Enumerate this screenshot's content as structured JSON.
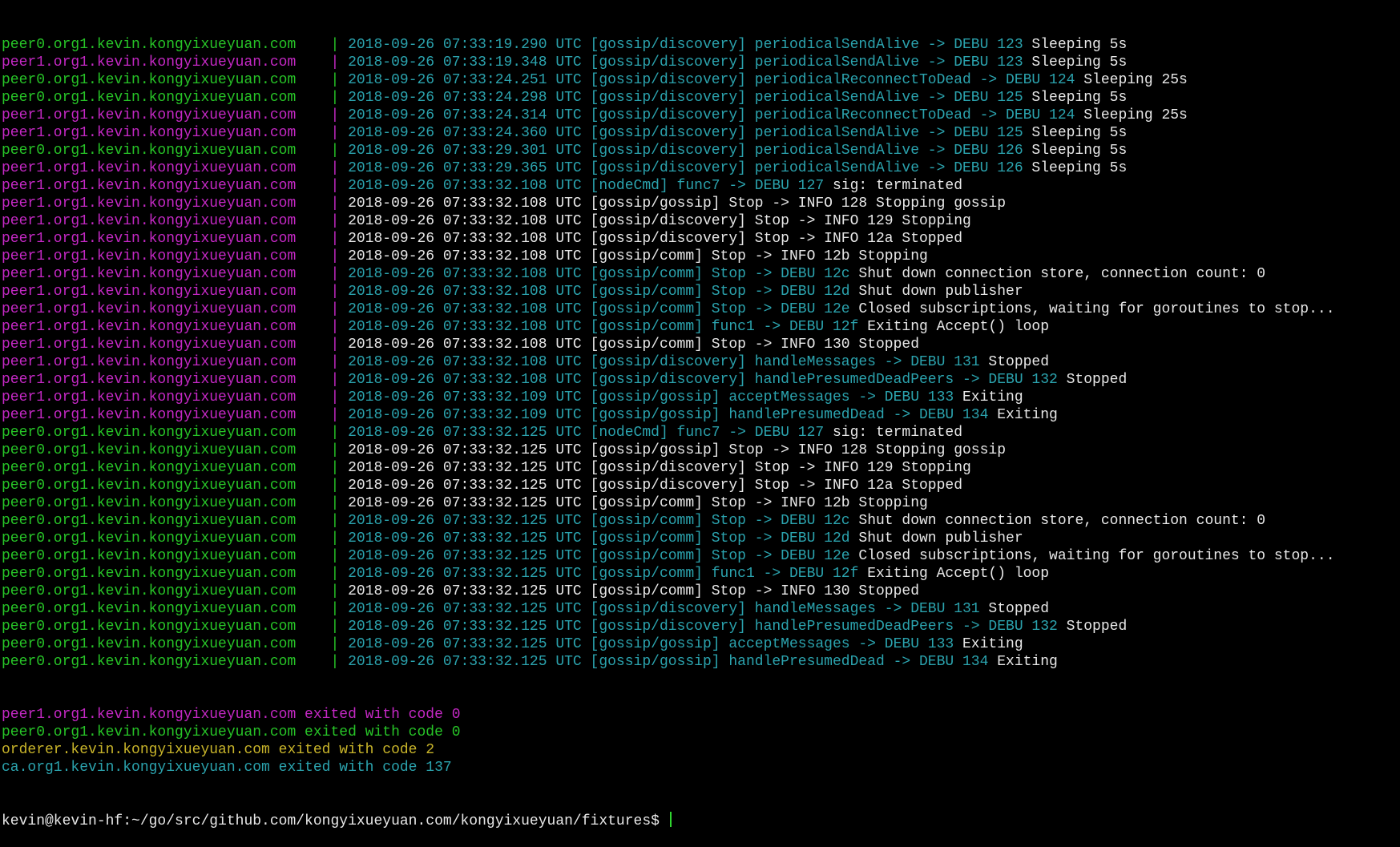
{
  "colors": {
    "green": "#27c427",
    "magenta": "#c428c4",
    "cyan": "#2ba3ae",
    "white": "#e8e8e8",
    "yellow": "#c9b52a",
    "background": "#000000"
  },
  "log_lines": [
    {
      "source": "peer0.org1.kevin.kongyixueyuan.com    ",
      "source_color": "green",
      "sep": "| ",
      "msg": "2018-09-26 07:33:19.290 UTC [gossip/discovery] periodicalSendAlive -> DEBU 123",
      "msg_color": "cyan",
      "tail": " Sleeping 5s"
    },
    {
      "source": "peer1.org1.kevin.kongyixueyuan.com    ",
      "source_color": "magenta",
      "sep": "| ",
      "msg": "2018-09-26 07:33:19.348 UTC [gossip/discovery] periodicalSendAlive -> DEBU 123",
      "msg_color": "cyan",
      "tail": " Sleeping 5s"
    },
    {
      "source": "peer0.org1.kevin.kongyixueyuan.com    ",
      "source_color": "green",
      "sep": "| ",
      "msg": "2018-09-26 07:33:24.251 UTC [gossip/discovery] periodicalReconnectToDead -> DEBU 124",
      "msg_color": "cyan",
      "tail": " Sleeping 25s"
    },
    {
      "source": "peer0.org1.kevin.kongyixueyuan.com    ",
      "source_color": "green",
      "sep": "| ",
      "msg": "2018-09-26 07:33:24.298 UTC [gossip/discovery] periodicalSendAlive -> DEBU 125",
      "msg_color": "cyan",
      "tail": " Sleeping 5s"
    },
    {
      "source": "peer1.org1.kevin.kongyixueyuan.com    ",
      "source_color": "magenta",
      "sep": "| ",
      "msg": "2018-09-26 07:33:24.314 UTC [gossip/discovery] periodicalReconnectToDead -> DEBU 124",
      "msg_color": "cyan",
      "tail": " Sleeping 25s"
    },
    {
      "source": "peer1.org1.kevin.kongyixueyuan.com    ",
      "source_color": "magenta",
      "sep": "| ",
      "msg": "2018-09-26 07:33:24.360 UTC [gossip/discovery] periodicalSendAlive -> DEBU 125",
      "msg_color": "cyan",
      "tail": " Sleeping 5s"
    },
    {
      "source": "peer0.org1.kevin.kongyixueyuan.com    ",
      "source_color": "green",
      "sep": "| ",
      "msg": "2018-09-26 07:33:29.301 UTC [gossip/discovery] periodicalSendAlive -> DEBU 126",
      "msg_color": "cyan",
      "tail": " Sleeping 5s"
    },
    {
      "source": "peer1.org1.kevin.kongyixueyuan.com    ",
      "source_color": "magenta",
      "sep": "| ",
      "msg": "2018-09-26 07:33:29.365 UTC [gossip/discovery] periodicalSendAlive -> DEBU 126",
      "msg_color": "cyan",
      "tail": " Sleeping 5s"
    },
    {
      "source": "peer1.org1.kevin.kongyixueyuan.com    ",
      "source_color": "magenta",
      "sep": "| ",
      "msg": "2018-09-26 07:33:32.108 UTC [nodeCmd] func7 -> DEBU 127",
      "msg_color": "cyan",
      "tail": " sig: terminated"
    },
    {
      "source": "peer1.org1.kevin.kongyixueyuan.com    ",
      "source_color": "magenta",
      "sep": "| ",
      "msg": "2018-09-26 07:33:32.108 UTC [gossip/gossip] Stop -> INFO 128 Stopping gossip",
      "msg_color": "white",
      "tail": ""
    },
    {
      "source": "peer1.org1.kevin.kongyixueyuan.com    ",
      "source_color": "magenta",
      "sep": "| ",
      "msg": "2018-09-26 07:33:32.108 UTC [gossip/discovery] Stop -> INFO 129 Stopping",
      "msg_color": "white",
      "tail": ""
    },
    {
      "source": "peer1.org1.kevin.kongyixueyuan.com    ",
      "source_color": "magenta",
      "sep": "| ",
      "msg": "2018-09-26 07:33:32.108 UTC [gossip/discovery] Stop -> INFO 12a Stopped",
      "msg_color": "white",
      "tail": ""
    },
    {
      "source": "peer1.org1.kevin.kongyixueyuan.com    ",
      "source_color": "magenta",
      "sep": "| ",
      "msg": "2018-09-26 07:33:32.108 UTC [gossip/comm] Stop -> INFO 12b Stopping",
      "msg_color": "white",
      "tail": ""
    },
    {
      "source": "peer1.org1.kevin.kongyixueyuan.com    ",
      "source_color": "magenta",
      "sep": "| ",
      "msg": "2018-09-26 07:33:32.108 UTC [gossip/comm] Stop -> DEBU 12c",
      "msg_color": "cyan",
      "tail": " Shut down connection store, connection count: 0"
    },
    {
      "source": "peer1.org1.kevin.kongyixueyuan.com    ",
      "source_color": "magenta",
      "sep": "| ",
      "msg": "2018-09-26 07:33:32.108 UTC [gossip/comm] Stop -> DEBU 12d",
      "msg_color": "cyan",
      "tail": " Shut down publisher"
    },
    {
      "source": "peer1.org1.kevin.kongyixueyuan.com    ",
      "source_color": "magenta",
      "sep": "| ",
      "msg": "2018-09-26 07:33:32.108 UTC [gossip/comm] Stop -> DEBU 12e",
      "msg_color": "cyan",
      "tail": " Closed subscriptions, waiting for goroutines to stop..."
    },
    {
      "source": "peer1.org1.kevin.kongyixueyuan.com    ",
      "source_color": "magenta",
      "sep": "| ",
      "msg": "2018-09-26 07:33:32.108 UTC [gossip/comm] func1 -> DEBU 12f",
      "msg_color": "cyan",
      "tail": " Exiting Accept() loop"
    },
    {
      "source": "peer1.org1.kevin.kongyixueyuan.com    ",
      "source_color": "magenta",
      "sep": "| ",
      "msg": "2018-09-26 07:33:32.108 UTC [gossip/comm] Stop -> INFO 130 Stopped",
      "msg_color": "white",
      "tail": ""
    },
    {
      "source": "peer1.org1.kevin.kongyixueyuan.com    ",
      "source_color": "magenta",
      "sep": "| ",
      "msg": "2018-09-26 07:33:32.108 UTC [gossip/discovery] handleMessages -> DEBU 131",
      "msg_color": "cyan",
      "tail": " Stopped"
    },
    {
      "source": "peer1.org1.kevin.kongyixueyuan.com    ",
      "source_color": "magenta",
      "sep": "| ",
      "msg": "2018-09-26 07:33:32.108 UTC [gossip/discovery] handlePresumedDeadPeers -> DEBU 132",
      "msg_color": "cyan",
      "tail": " Stopped"
    },
    {
      "source": "peer1.org1.kevin.kongyixueyuan.com    ",
      "source_color": "magenta",
      "sep": "| ",
      "msg": "2018-09-26 07:33:32.109 UTC [gossip/gossip] acceptMessages -> DEBU 133",
      "msg_color": "cyan",
      "tail": " Exiting"
    },
    {
      "source": "peer1.org1.kevin.kongyixueyuan.com    ",
      "source_color": "magenta",
      "sep": "| ",
      "msg": "2018-09-26 07:33:32.109 UTC [gossip/gossip] handlePresumedDead -> DEBU 134",
      "msg_color": "cyan",
      "tail": " Exiting"
    },
    {
      "source": "peer0.org1.kevin.kongyixueyuan.com    ",
      "source_color": "green",
      "sep": "| ",
      "msg": "2018-09-26 07:33:32.125 UTC [nodeCmd] func7 -> DEBU 127",
      "msg_color": "cyan",
      "tail": " sig: terminated"
    },
    {
      "source": "peer0.org1.kevin.kongyixueyuan.com    ",
      "source_color": "green",
      "sep": "| ",
      "msg": "2018-09-26 07:33:32.125 UTC [gossip/gossip] Stop -> INFO 128 Stopping gossip",
      "msg_color": "white",
      "tail": ""
    },
    {
      "source": "peer0.org1.kevin.kongyixueyuan.com    ",
      "source_color": "green",
      "sep": "| ",
      "msg": "2018-09-26 07:33:32.125 UTC [gossip/discovery] Stop -> INFO 129 Stopping",
      "msg_color": "white",
      "tail": ""
    },
    {
      "source": "peer0.org1.kevin.kongyixueyuan.com    ",
      "source_color": "green",
      "sep": "| ",
      "msg": "2018-09-26 07:33:32.125 UTC [gossip/discovery] Stop -> INFO 12a Stopped",
      "msg_color": "white",
      "tail": ""
    },
    {
      "source": "peer0.org1.kevin.kongyixueyuan.com    ",
      "source_color": "green",
      "sep": "| ",
      "msg": "2018-09-26 07:33:32.125 UTC [gossip/comm] Stop -> INFO 12b Stopping",
      "msg_color": "white",
      "tail": ""
    },
    {
      "source": "peer0.org1.kevin.kongyixueyuan.com    ",
      "source_color": "green",
      "sep": "| ",
      "msg": "2018-09-26 07:33:32.125 UTC [gossip/comm] Stop -> DEBU 12c",
      "msg_color": "cyan",
      "tail": " Shut down connection store, connection count: 0"
    },
    {
      "source": "peer0.org1.kevin.kongyixueyuan.com    ",
      "source_color": "green",
      "sep": "| ",
      "msg": "2018-09-26 07:33:32.125 UTC [gossip/comm] Stop -> DEBU 12d",
      "msg_color": "cyan",
      "tail": " Shut down publisher"
    },
    {
      "source": "peer0.org1.kevin.kongyixueyuan.com    ",
      "source_color": "green",
      "sep": "| ",
      "msg": "2018-09-26 07:33:32.125 UTC [gossip/comm] Stop -> DEBU 12e",
      "msg_color": "cyan",
      "tail": " Closed subscriptions, waiting for goroutines to stop..."
    },
    {
      "source": "peer0.org1.kevin.kongyixueyuan.com    ",
      "source_color": "green",
      "sep": "| ",
      "msg": "2018-09-26 07:33:32.125 UTC [gossip/comm] func1 -> DEBU 12f",
      "msg_color": "cyan",
      "tail": " Exiting Accept() loop"
    },
    {
      "source": "peer0.org1.kevin.kongyixueyuan.com    ",
      "source_color": "green",
      "sep": "| ",
      "msg": "2018-09-26 07:33:32.125 UTC [gossip/comm] Stop -> INFO 130 Stopped",
      "msg_color": "white",
      "tail": ""
    },
    {
      "source": "peer0.org1.kevin.kongyixueyuan.com    ",
      "source_color": "green",
      "sep": "| ",
      "msg": "2018-09-26 07:33:32.125 UTC [gossip/discovery] handleMessages -> DEBU 131",
      "msg_color": "cyan",
      "tail": " Stopped"
    },
    {
      "source": "peer0.org1.kevin.kongyixueyuan.com    ",
      "source_color": "green",
      "sep": "| ",
      "msg": "2018-09-26 07:33:32.125 UTC [gossip/discovery] handlePresumedDeadPeers -> DEBU 132",
      "msg_color": "cyan",
      "tail": " Stopped"
    },
    {
      "source": "peer0.org1.kevin.kongyixueyuan.com    ",
      "source_color": "green",
      "sep": "| ",
      "msg": "2018-09-26 07:33:32.125 UTC [gossip/gossip] acceptMessages -> DEBU 133",
      "msg_color": "cyan",
      "tail": " Exiting"
    },
    {
      "source": "peer0.org1.kevin.kongyixueyuan.com    ",
      "source_color": "green",
      "sep": "| ",
      "msg": "2018-09-26 07:33:32.125 UTC [gossip/gossip] handlePresumedDead -> DEBU 134",
      "msg_color": "cyan",
      "tail": " Exiting"
    }
  ],
  "exit_lines": [
    {
      "text": "peer1.org1.kevin.kongyixueyuan.com exited with code 0",
      "color": "magenta"
    },
    {
      "text": "peer0.org1.kevin.kongyixueyuan.com exited with code 0",
      "color": "green"
    },
    {
      "text": "orderer.kevin.kongyixueyuan.com exited with code 2",
      "color": "yellow"
    },
    {
      "text": "ca.org1.kevin.kongyixueyuan.com exited with code 137",
      "color": "teal"
    }
  ],
  "prompt": {
    "text": "kevin@kevin-hf:~/go/src/github.com/kongyixueyuan.com/kongyixueyuan/fixtures$ ",
    "color": "white"
  }
}
